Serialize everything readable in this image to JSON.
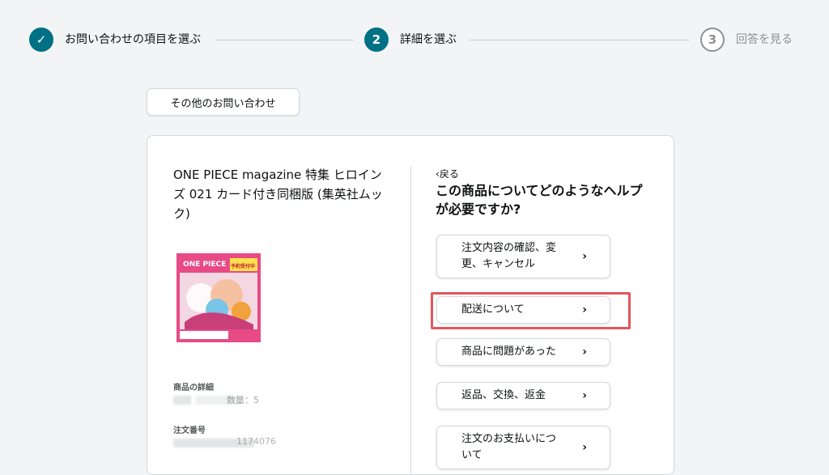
{
  "stepper": {
    "steps": [
      {
        "marker": "✓",
        "label": "お問い合わせの項目を選ぶ",
        "state": "done"
      },
      {
        "marker": "2",
        "label": "詳細を選ぶ",
        "state": "active"
      },
      {
        "marker": "3",
        "label": "回答を見る",
        "state": "pending"
      }
    ]
  },
  "other_inquiry_label": "その他のお問い合わせ",
  "product": {
    "title": "ONE PIECE magazine 特集 ヒロインズ 021 カード付き同梱版 (集英社ムック)",
    "image_label": "ONE PIECE",
    "image_banner": "予約受付中",
    "details_label": "商品の詳細",
    "details_value_fragment": "数量：5",
    "order_number_label": "注文番号",
    "order_number_fragment": "1174076"
  },
  "help": {
    "back_label": "戻る",
    "heading": "この商品についてどのようなヘルプが必要ですか?",
    "options": [
      {
        "label": "注文内容の確認、変更、キャンセル"
      },
      {
        "label": "配送について",
        "highlighted": true
      },
      {
        "label": "商品に問題があった"
      },
      {
        "label": "返品、交換、返金"
      },
      {
        "label": "注文のお支払いについて"
      }
    ]
  },
  "colors": {
    "accent": "#007185",
    "highlight": "#e4555a"
  }
}
